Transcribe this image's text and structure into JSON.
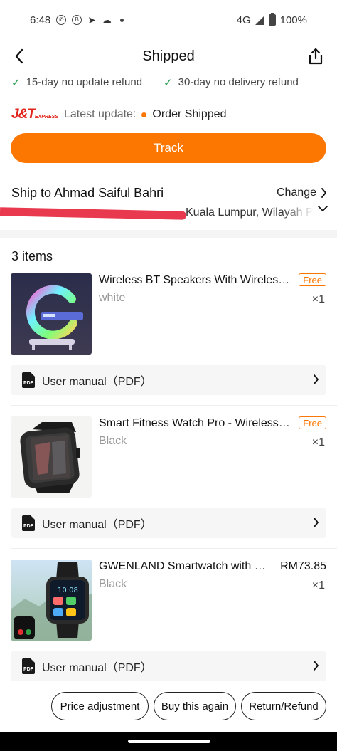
{
  "status_bar": {
    "time": "6:48",
    "network": "4G",
    "battery": "100%"
  },
  "header": {
    "title": "Shipped"
  },
  "guarantees": [
    {
      "label": "15-day no update refund"
    },
    {
      "label": "30-day no delivery refund"
    }
  ],
  "courier": {
    "logo_main": "J&T",
    "logo_sub": "EXPRESS",
    "latest_label": "Latest update:",
    "latest_value": "Order Shipped"
  },
  "track_button": "Track",
  "shipping": {
    "ship_to": "Ship to Ahmad Saiful Bahri",
    "change_label": "Change",
    "address_visible": "Kuala Lumpur, Wilayah P"
  },
  "items_title": "3 items",
  "items": [
    {
      "name": "Wireless BT Speakers With Wireless Charger",
      "variant": "white",
      "qty": "×1",
      "badge": "Free",
      "manual": "User manual（PDF）"
    },
    {
      "name": "Smart Fitness Watch Pro - Wireless Calling",
      "variant": "Black",
      "qty": "×1",
      "badge": "Free",
      "manual": "User manual（PDF）"
    },
    {
      "name": "GWENLAND Smartwatch with Wireless Calling",
      "variant": "Black",
      "qty": "×1",
      "price": "RM73.85",
      "manual": "User manual（PDF）"
    }
  ],
  "pdf_label": "PDF",
  "actions": {
    "price_adjustment": "Price adjustment",
    "buy_again": "Buy this again",
    "return_refund": "Return/Refund"
  },
  "colors": {
    "accent": "#fb7701",
    "check": "#1c9b4b",
    "courier_red": "#e1251b",
    "redaction": "#e8394e"
  }
}
